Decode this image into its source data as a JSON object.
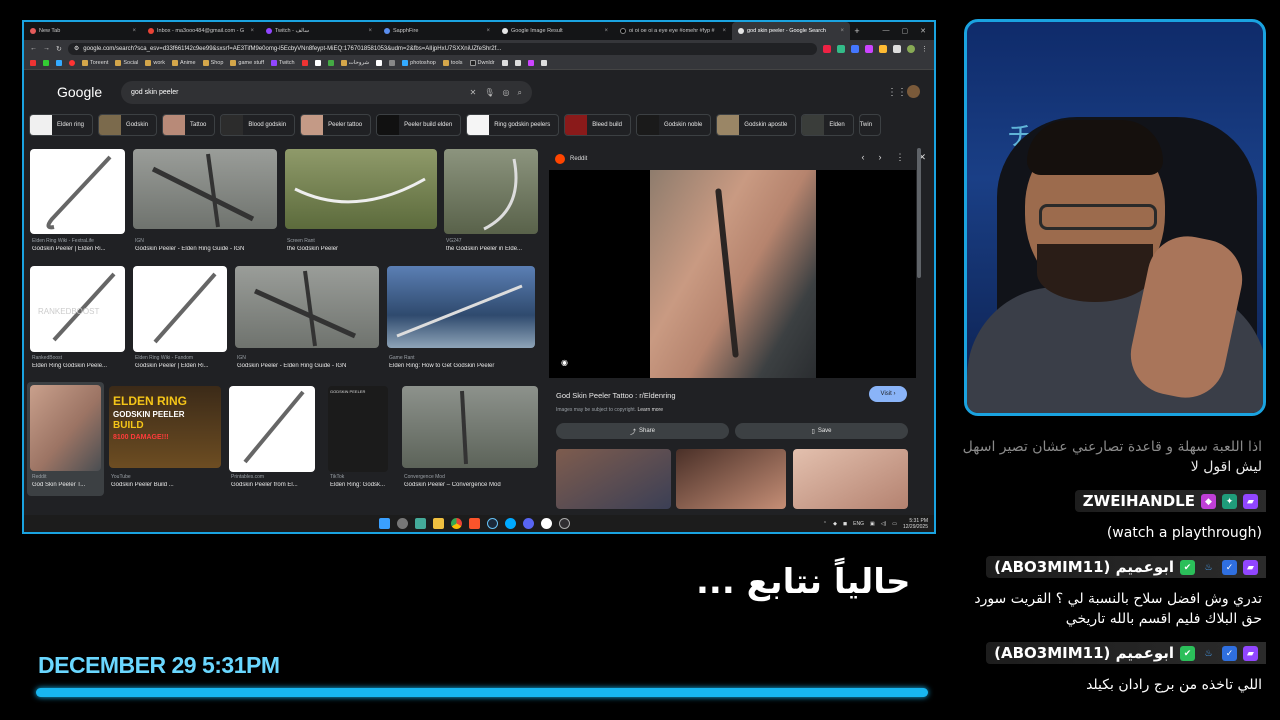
{
  "browser": {
    "tabs": [
      {
        "label": "New Tab",
        "color": "#e35b5b"
      },
      {
        "label": "Inbox - ma3ooo484@gmail.com - G",
        "color": "#ea4335"
      },
      {
        "label": "Twitch - سالف",
        "color": "#9146ff"
      },
      {
        "label": "SapphFire",
        "color": "#5a8dee"
      },
      {
        "label": "Google Image Result",
        "color": "#e5e5e5"
      },
      {
        "label": "oi oi oe oi a eye eye #omehr #fyp #",
        "color": "#000000"
      },
      {
        "label": "god skin peeler - Google Search",
        "color": "#4285f4",
        "active": true
      }
    ],
    "url": "google.com/search?sca_esv=d33f661f42c9ee99&sxsrf=AE3TifM9e0omg-l5EcbyVNn8feypt-MiEQ:1767018581053&udm=2&fbs=AIIjpHxU7SXXniUZfeShr2f...",
    "bookmarks": [
      "Toreent",
      "Social",
      "work",
      "Anime",
      "Shop",
      "game stuff",
      "Twitch",
      "شروحات",
      "photoshop",
      "tools",
      "Dwnldr"
    ]
  },
  "google": {
    "logo": "Google",
    "query": "god skin peeler",
    "chips": [
      "Elden ring",
      "Godskin",
      "Tattoo",
      "Blood godskin",
      "Peeler tattoo",
      "Peeler build elden",
      "Ring godskin peelers",
      "Bleed build",
      "Godskin noble",
      "Godskin apostle",
      "Elden",
      "Twin"
    ],
    "results": [
      {
        "source": "Elden Ring Wiki - FextraLife",
        "title": "Godskin Peeler | Elden Ri..."
      },
      {
        "source": "IGN",
        "title": "Godskin Peeler - Elden Ring Guide - IGN"
      },
      {
        "source": "Screen Rant",
        "title": "the Godskin Peeler"
      },
      {
        "source": "VG247",
        "title": "the Godskin Peeler in Elde..."
      },
      {
        "source": "RankedBoost",
        "title": "Elden Ring Godskin Peele..."
      },
      {
        "source": "Elden Ring Wiki - Fandom",
        "title": "Godskin Peeler | Elden Ri..."
      },
      {
        "source": "IGN",
        "title": "Godskin Peeler - Elden Ring Guide - IGN"
      },
      {
        "source": "Game Rant",
        "title": "Elden Ring: How to Get Godskin Peeler"
      },
      {
        "source": "Reddit",
        "title": "God Skin Peeler T..."
      },
      {
        "source": "YouTube",
        "title": "Godskin Peeler Build ..."
      },
      {
        "source": "Printables.com",
        "title": "Godskin Peeler from El..."
      },
      {
        "source": "TikTok",
        "title": "Elden Ring: Godsk..."
      },
      {
        "source": "Convergence Mod",
        "title": "Godskin Peeler – Convergence Mod"
      }
    ],
    "thumb_text": {
      "watermark1": "RANKEDBOOST",
      "yt_line1": "ELDEN RING",
      "yt_line2": "GODSKIN PEELER",
      "yt_line3": "BUILD",
      "yt_line4": "8100 DAMAGE!!!",
      "tiktok_label": "GODSKIN PEELER"
    },
    "preview": {
      "source": "Reddit",
      "title": "God Skin Peeler Tattoo : r/Eldenring",
      "visit": "Visit",
      "copyright": "Images may be subject to copyright.",
      "learn_more": "Learn more",
      "share": "Share",
      "save": "Save"
    }
  },
  "taskbar": {
    "lang": "ENG",
    "time": "5:31 PM",
    "date": "12/29/2025"
  },
  "chat": {
    "prev_line1": "اذا اللعبة سهلة و قاعدة تصارعني عشان تصير اسهل",
    "prev_line2": "ليش اقول لا",
    "messages": [
      {
        "user": "ZWEIHANDLE",
        "text": "(watch a playthrough)"
      },
      {
        "user": "ابوعميم (ABO3MIM11)",
        "text": "تدري وش افضل سلاح بالنسبة لي ؟ القريت سورد حق البلاك فليم اقسم بالله تاريخي"
      },
      {
        "user": "ابوعميم (ABO3MIM11)",
        "text": "اللي تاخذه من برج رادان بكيلد"
      }
    ]
  },
  "overlay": {
    "now_watching": "حالياً نتابع ...",
    "datetime": "DECEMBER 29 5:31PM"
  },
  "colors": {
    "accent": "#1aa3e0",
    "twitch": "#9146ff"
  }
}
